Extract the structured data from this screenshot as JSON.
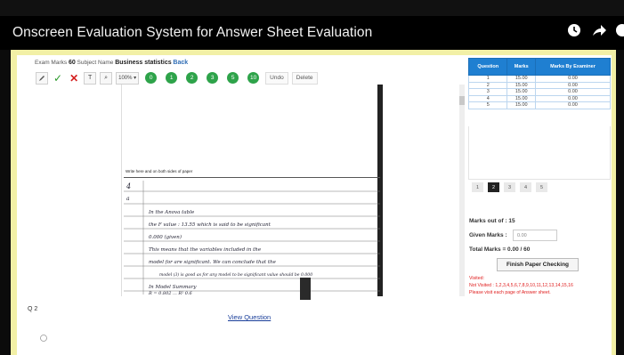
{
  "video": {
    "title": "Onscreen Evaluation System for Answer Sheet Evaluation",
    "icons": [
      "clock-icon",
      "share-icon",
      "info-icon"
    ]
  },
  "exam": {
    "marks_label": "Exam Marks",
    "marks_value": "60",
    "subject_label": "Subject Name",
    "subject_value": "Business statistics",
    "back_label": "Back"
  },
  "toolbar": {
    "zoom": "100% ▾",
    "marks": [
      "0",
      "1",
      "2",
      "3",
      "5",
      "10"
    ],
    "undo_label": "Undo",
    "delete_label": "Delete"
  },
  "sheet": {
    "header_text": "Write here and on both sides of paper",
    "handwriting": [
      "4",
      "a",
      "In the Anova table",
      "the F value : 13.55 which is said to be significant",
      "0.000 (given)",
      "This means that the variables included in the",
      "model for are significant. We can conclude that the",
      "model (3) is good as for any model to be significant value should be 0.000",
      "In Model Summary",
      "R = 0.802 ... R² 0.6"
    ]
  },
  "question_nav": {
    "current_label": "Q 2",
    "view_question_label": "View Question"
  },
  "marks_table": {
    "headers": [
      "Question",
      "Marks",
      "Marks By Examiner"
    ],
    "rows": [
      [
        "1",
        "15.00",
        "0.00"
      ],
      [
        "2",
        "15.00",
        "0.00"
      ],
      [
        "3",
        "15.00",
        "0.00"
      ],
      [
        "4",
        "15.00",
        "0.00"
      ],
      [
        "5",
        "15.00",
        "0.00"
      ]
    ]
  },
  "pager": {
    "pages": [
      "1",
      "2",
      "3",
      "4",
      "5"
    ],
    "active_index": 1
  },
  "summary": {
    "marks_out_of": "Marks out of : 15",
    "given_label": "Given Marks :",
    "given_value": "0.00",
    "total": "Total Marks = 0.00 /  60",
    "finish_label": "Finish Paper Checking",
    "visited": "Visited:",
    "not_visited": "Not Visited : 1,2,3,4,5,6,7,8,9,10,11,12,13,14,15,16",
    "notice": "Please visit each page of Answer sheet."
  },
  "colors": {
    "accent": "#1f7fd1",
    "marker_green": "#2ea34a",
    "alert_red": "#e02020",
    "frame_yellow": "#f2f0a6"
  }
}
